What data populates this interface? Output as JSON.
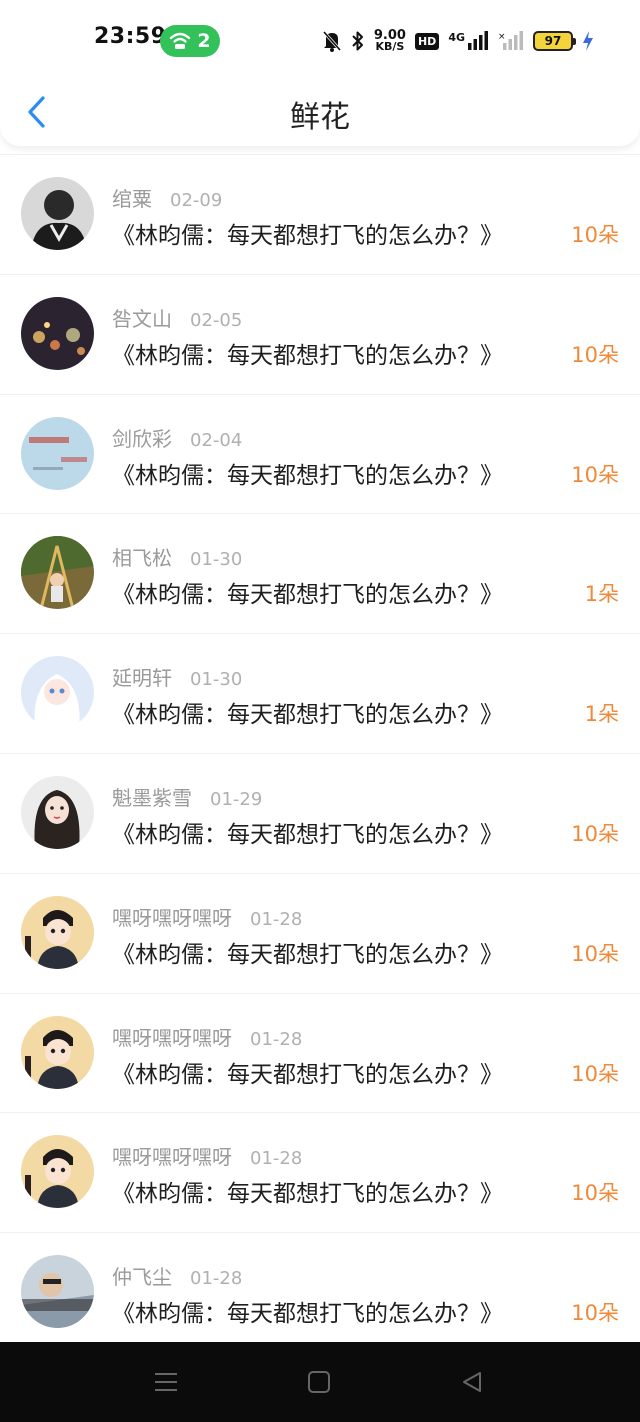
{
  "status_bar": {
    "time": "23:59",
    "hotspot_count": "2",
    "net_speed_value": "9.00",
    "net_speed_unit": "KB/S",
    "hd_label": "HD",
    "network_label": "4G",
    "battery_level": "97",
    "icons": [
      "wifi-hotspot-icon",
      "mute-bell-icon",
      "bluetooth-icon",
      "signal-icon",
      "charging-icon"
    ]
  },
  "header": {
    "title": "鲜花",
    "back_icon": "chevron-left-icon",
    "accent_color": "#2b8cf0"
  },
  "list": {
    "count_color": "#f08a3a",
    "items": [
      {
        "name": "绾粟",
        "date": "02-09",
        "title": "《林昀儒：每天都想打飞的怎么办？》",
        "count": "10朵"
      },
      {
        "name": "咎文山",
        "date": "02-05",
        "title": "《林昀儒：每天都想打飞的怎么办？》",
        "count": "10朵"
      },
      {
        "name": "剑欣彩",
        "date": "02-04",
        "title": "《林昀儒：每天都想打飞的怎么办？》",
        "count": "10朵"
      },
      {
        "name": "相飞松",
        "date": "01-30",
        "title": "《林昀儒：每天都想打飞的怎么办？》",
        "count": "1朵"
      },
      {
        "name": "延明轩",
        "date": "01-30",
        "title": "《林昀儒：每天都想打飞的怎么办？》",
        "count": "1朵"
      },
      {
        "name": "魁墨紫雪",
        "date": "01-29",
        "title": "《林昀儒：每天都想打飞的怎么办？》",
        "count": "10朵"
      },
      {
        "name": "嘿呀嘿呀嘿呀",
        "date": "01-28",
        "title": "《林昀儒：每天都想打飞的怎么办？》",
        "count": "10朵"
      },
      {
        "name": "嘿呀嘿呀嘿呀",
        "date": "01-28",
        "title": "《林昀儒：每天都想打飞的怎么办？》",
        "count": "10朵"
      },
      {
        "name": "嘿呀嘿呀嘿呀",
        "date": "01-28",
        "title": "《林昀儒：每天都想打飞的怎么办？》",
        "count": "10朵"
      },
      {
        "name": "仲飞尘",
        "date": "01-28",
        "title": "《林昀儒：每天都想打飞的怎么办？》",
        "count": "10朵"
      }
    ]
  },
  "nav_bar": {
    "icons": [
      "menu-icon",
      "home-square-icon",
      "back-triangle-icon"
    ]
  }
}
